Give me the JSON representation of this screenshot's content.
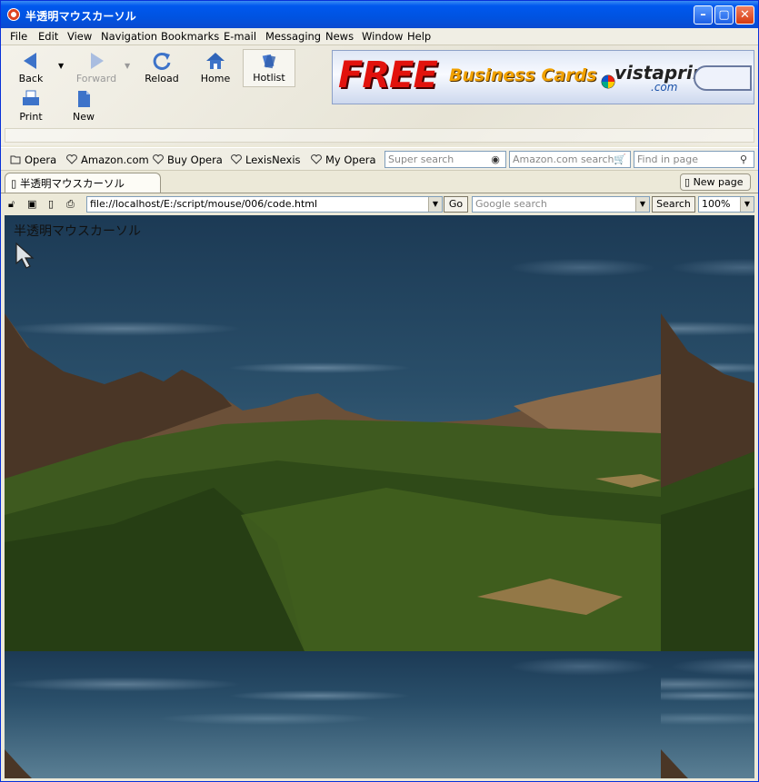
{
  "window": {
    "title": "半透明マウスカーソル"
  },
  "menu": [
    "File",
    "Edit",
    "View",
    "Navigation",
    "Bookmarks",
    "E-mail",
    "Messaging",
    "News",
    "Window",
    "Help"
  ],
  "toolbar": {
    "back": "Back",
    "forward": "Forward",
    "reload": "Reload",
    "home": "Home",
    "hotlist": "Hotlist",
    "print": "Print",
    "new": "New"
  },
  "ad": {
    "free": "FREE",
    "text": "Business Cards",
    "brand": "vistaprint",
    "tld": ".com"
  },
  "bookmarks": [
    "Opera",
    "Amazon.com",
    "Buy Opera",
    "LexisNexis",
    "My Opera"
  ],
  "search": {
    "super_placeholder": "Super search",
    "amazon_placeholder": "Amazon.com search",
    "find_placeholder": "Find in page"
  },
  "tab": {
    "label": "半透明マウスカーソル",
    "new_page": "New page"
  },
  "address": {
    "url": "file://localhost/E:/script/mouse/006/code.html",
    "go": "Go",
    "google_placeholder": "Google search",
    "search_button": "Search",
    "zoom": "100%"
  },
  "page": {
    "heading": "半透明マウスカーソル"
  }
}
